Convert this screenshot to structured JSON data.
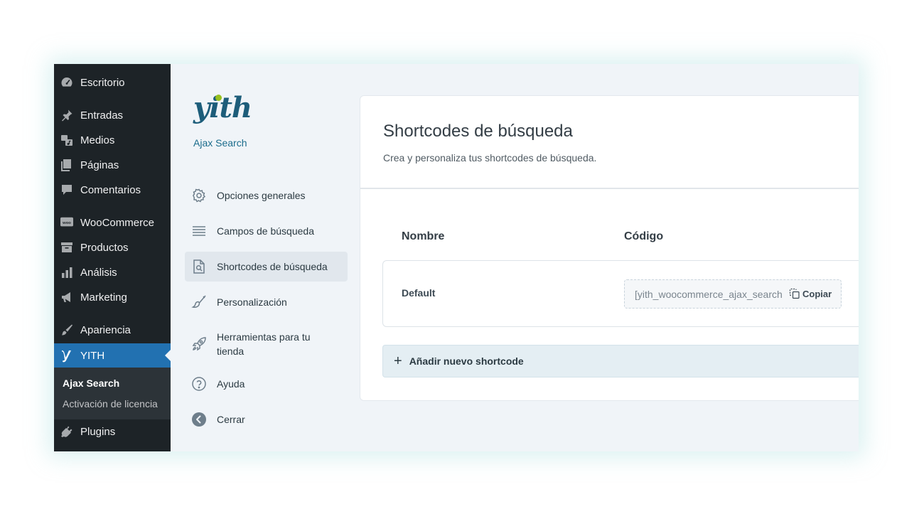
{
  "wp_menu": {
    "items": [
      {
        "label": "Escritorio",
        "icon": "dashboard-icon"
      },
      {
        "label": "Entradas",
        "icon": "pin-icon"
      },
      {
        "label": "Medios",
        "icon": "media-icon"
      },
      {
        "label": "Páginas",
        "icon": "pages-icon"
      },
      {
        "label": "Comentarios",
        "icon": "comment-icon"
      },
      {
        "label": "WooCommerce",
        "icon": "woo-icon"
      },
      {
        "label": "Productos",
        "icon": "archive-icon"
      },
      {
        "label": "Análisis",
        "icon": "bar-chart-icon"
      },
      {
        "label": "Marketing",
        "icon": "megaphone-icon"
      },
      {
        "label": "Apariencia",
        "icon": "brush-icon"
      },
      {
        "label": "YITH",
        "icon": "yith-icon"
      },
      {
        "label": "Plugins",
        "icon": "plug-icon"
      }
    ],
    "submenu": [
      {
        "label": "Ajax Search"
      },
      {
        "label": "Activación de licencia"
      }
    ]
  },
  "plugin": {
    "logo": "yith",
    "name": "Ajax Search",
    "brand_color": "#1d5d7a",
    "accent_color": "#97c01e",
    "nav": [
      {
        "label": "Opciones generales",
        "icon": "gear-icon"
      },
      {
        "label": "Campos de búsqueda",
        "icon": "list-icon"
      },
      {
        "label": "Shortcodes de búsqueda",
        "icon": "search-file-icon"
      },
      {
        "label": "Personalización",
        "icon": "paint-brush-icon"
      },
      {
        "label": "Herramientas para tu tienda",
        "icon": "rocket-icon"
      },
      {
        "label": "Ayuda",
        "icon": "help-icon"
      },
      {
        "label": "Cerrar",
        "icon": "arrow-left-circle-icon"
      }
    ]
  },
  "main": {
    "title": "Shortcodes de búsqueda",
    "description": "Crea y personaliza tus shortcodes de búsqueda.",
    "columns": [
      "Nombre",
      "Código"
    ],
    "rows": [
      {
        "name": "Default",
        "code": "[yith_woocommerce_ajax_search"
      }
    ],
    "copy_label": "Copiar",
    "add_label": "Añadir nuevo shortcode"
  }
}
